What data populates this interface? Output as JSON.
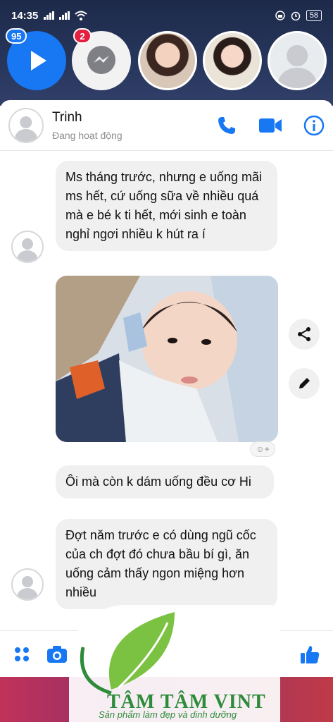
{
  "status_bar": {
    "time": "14:35",
    "battery": "58"
  },
  "chat_heads": {
    "play_badge": "95",
    "messenger_badge": "2"
  },
  "header": {
    "name": "Trinh",
    "status": "Đang hoạt động"
  },
  "messages": [
    {
      "text": "Ms tháng trước, nhưng e uống mãi ms hết, cứ uống sữa về nhiều quá mà e bé k ti hết, mới sinh e toàn nghỉ ngơi nhiều k hút ra í"
    },
    {
      "text": "Ôi mà còn k dám uống đều cơ Hi"
    },
    {
      "text": "Đợt năm trước e có dùng ngũ cốc của ch đợt đó chưa bầu bí gì, ăn uống cảm thấy ngon miệng hơn nhiều"
    }
  ],
  "watermark": {
    "title": "TÂM TÂM VINT",
    "subtitle": "Sản phẩm làm đẹp và dinh dưỡng"
  },
  "colors": {
    "messenger_blue": "#1877f2",
    "bubble_gray": "#f0f0f0",
    "logo_green": "#2e8b3a"
  }
}
